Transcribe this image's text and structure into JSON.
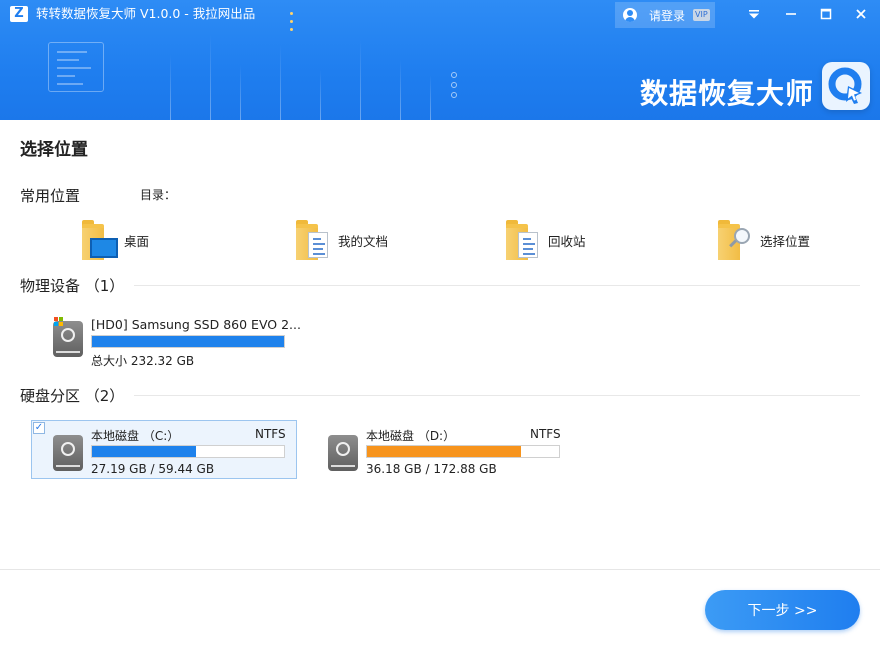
{
  "app": {
    "title": "转转数据恢复大师 V1.0.0 - 我拉网出品",
    "logo_letter": "Z",
    "brand": "数据恢复大师"
  },
  "header": {
    "login_label": "请登录",
    "vip_badge": "VIP",
    "controls": {
      "menu": "menu-icon",
      "minimize": "minimize-icon",
      "maximize": "maximize-icon",
      "close": "close-icon"
    }
  },
  "page": {
    "title": "选择位置",
    "common_section": "常用位置",
    "dir_label": "目录：",
    "locations": [
      {
        "label": "桌面",
        "icon": "desktop-folder-icon"
      },
      {
        "label": "我的文档",
        "icon": "documents-folder-icon"
      },
      {
        "label": "回收站",
        "icon": "recycle-bin-folder-icon"
      },
      {
        "label": "选择位置",
        "icon": "search-folder-icon"
      }
    ]
  },
  "physical": {
    "title": "物理设备 （1）",
    "devices": [
      {
        "name": "[HD0] Samsung SSD 860 EVO 2...",
        "size": "总大小 232.32 GB",
        "usage_fraction": 1.0,
        "bar_color": "#1e82ec"
      }
    ]
  },
  "partitions": {
    "title": "硬盘分区 （2）",
    "items": [
      {
        "name": "本地磁盘 （C:）",
        "fs": "NTFS",
        "size": "27.19 GB / 59.44 GB",
        "usage_fraction": 0.5425,
        "bar_color": "#1e82ec",
        "selected": true,
        "check": "✓"
      },
      {
        "name": "本地磁盘 （D:）",
        "fs": "NTFS",
        "size": "36.18 GB / 172.88 GB",
        "usage_fraction": 0.8,
        "bar_color": "#f7941d",
        "selected": false
      }
    ]
  },
  "footer": {
    "next_label": "下一步 >>"
  },
  "colors": {
    "header_blue": "#1f7eef",
    "accent_blue": "#1e82ec",
    "accent_orange": "#f7941d"
  }
}
